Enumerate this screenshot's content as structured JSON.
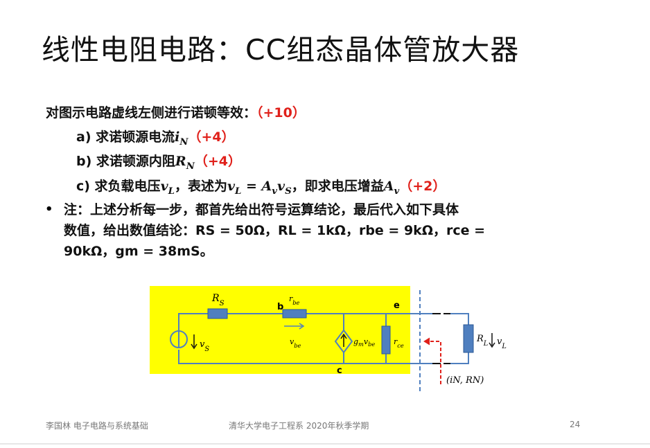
{
  "slide": {
    "title": "线性电阻电路：CC组态晶体管放大器",
    "task": {
      "text": "对图示电路虚线左侧进行诺顿等效：",
      "points": "（+10）"
    },
    "item_a": {
      "text": "a) 求诺顿源电流",
      "math": "iN",
      "points": "（+4）"
    },
    "item_b": {
      "text": "b) 求诺顿源内阻",
      "math": "RN",
      "points": "（+4）"
    },
    "item_c": {
      "text1": "c) 求负载电压",
      "math1": "vL",
      "text2": "，表述为",
      "math2": "vL = AvvS",
      "text3": "，即求电压增益",
      "math3": "Av",
      "points": "（+2）"
    },
    "note_bullet": "•",
    "note_line1": "注：上述分析每一步，都首先给出符号运算结论，最后代入如下具体",
    "note_line2": "数值，给出数值结论：RS = 50Ω，RL = 1kΩ，rbe = 9kΩ，rce =",
    "note_line3": "90kΩ，gm = 38mS。"
  },
  "circuit": {
    "highlight_color": "#ffff00",
    "wire_color": "#4f7fbf",
    "arrow_color": "#e0201a",
    "labels": {
      "rs": "RS",
      "rbe": "rbe",
      "node_b": "b",
      "node_e": "e",
      "node_c": "c",
      "vs": "vS",
      "vbe": "vbe",
      "gm_vbe": "gmvbe",
      "rce": "rce",
      "rl": "RL",
      "vl": "vL",
      "norton": "(iN, RN)"
    }
  },
  "footer": {
    "author_course": "李国林   电子电路与系统基础",
    "dept_term": "清华大学电子工程系  2020年秋季学期",
    "page": "24"
  }
}
